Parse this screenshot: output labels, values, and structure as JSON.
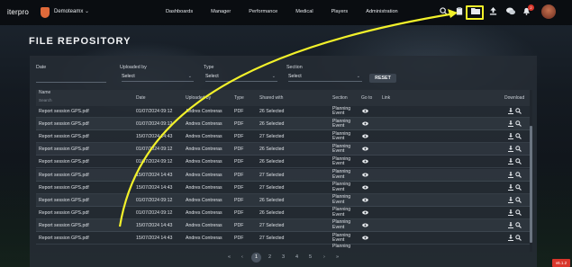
{
  "app": {
    "logo": "iterpro",
    "team": "Demoteamx",
    "nav": [
      "Dashboards",
      "Manager",
      "Performance",
      "Medical",
      "Players",
      "Administration"
    ],
    "notifications_count": "2",
    "accent_color": "#f2f12a",
    "version_badge": "v6.1.2"
  },
  "page": {
    "title": "FILE REPOSITORY"
  },
  "filters": {
    "date_label": "Date",
    "uploaded_by_label": "Uploaded by",
    "uploaded_by_value": "Select",
    "type_label": "Type",
    "type_value": "Select",
    "section_label": "Section",
    "section_value": "Select",
    "reset_label": "RESET"
  },
  "table": {
    "headers": {
      "name": "Name",
      "search_placeholder": "Search",
      "date": "Date",
      "uploaded_by": "Uploaded by",
      "type": "Type",
      "shared_with": "Shared with",
      "section": "Section",
      "go_to": "Go to",
      "link": "Link",
      "download": "Download"
    },
    "rows": [
      {
        "name": "Report session GPS.pdf",
        "date": "01/07/2024 09:12",
        "uploaded_by": "Andres Contreras",
        "type": "PDF",
        "shared_with": "26 Selected",
        "section_1": "Planning",
        "section_2": "Event"
      },
      {
        "name": "Report session GPS.pdf",
        "date": "01/07/2024 09:12",
        "uploaded_by": "Andres Contreras",
        "type": "PDF",
        "shared_with": "26 Selected",
        "section_1": "Planning",
        "section_2": "Event"
      },
      {
        "name": "Report session GPS.pdf",
        "date": "15/07/2024 14:43",
        "uploaded_by": "Andres Contreras",
        "type": "PDF",
        "shared_with": "27 Selected",
        "section_1": "Planning",
        "section_2": "Event"
      },
      {
        "name": "Report session GPS.pdf",
        "date": "01/07/2024 09:12",
        "uploaded_by": "Andres Contreras",
        "type": "PDF",
        "shared_with": "26 Selected",
        "section_1": "Planning",
        "section_2": "Event"
      },
      {
        "name": "Report session GPS.pdf",
        "date": "01/07/2024 09:12",
        "uploaded_by": "Andres Contreras",
        "type": "PDF",
        "shared_with": "26 Selected",
        "section_1": "Planning",
        "section_2": "Event"
      },
      {
        "name": "Report session GPS.pdf",
        "date": "15/07/2024 14:43",
        "uploaded_by": "Andres Contreras",
        "type": "PDF",
        "shared_with": "27 Selected",
        "section_1": "Planning",
        "section_2": "Event"
      },
      {
        "name": "Report session GPS.pdf",
        "date": "15/07/2024 14:43",
        "uploaded_by": "Andres Contreras",
        "type": "PDF",
        "shared_with": "27 Selected",
        "section_1": "Planning",
        "section_2": "Event"
      },
      {
        "name": "Report session GPS.pdf",
        "date": "01/07/2024 09:12",
        "uploaded_by": "Andres Contreras",
        "type": "PDF",
        "shared_with": "26 Selected",
        "section_1": "Planning",
        "section_2": "Event"
      },
      {
        "name": "Report session GPS.pdf",
        "date": "01/07/2024 09:12",
        "uploaded_by": "Andres Contreras",
        "type": "PDF",
        "shared_with": "26 Selected",
        "section_1": "Planning",
        "section_2": "Event"
      },
      {
        "name": "Report session GPS.pdf",
        "date": "15/07/2024 14:43",
        "uploaded_by": "Andres Contreras",
        "type": "PDF",
        "shared_with": "27 Selected",
        "section_1": "Planning",
        "section_2": "Event"
      },
      {
        "name": "Report session GPS.pdf",
        "date": "15/07/2024 14:43",
        "uploaded_by": "Andres Contreras",
        "type": "PDF",
        "shared_with": "27 Selected",
        "section_1": "Planning",
        "section_2": "Event"
      }
    ],
    "partial_row_label": "Planning"
  },
  "pagination": {
    "first": "«",
    "prev": "‹",
    "pages": [
      "1",
      "2",
      "3",
      "4",
      "5"
    ],
    "active_page": "1",
    "next": "›",
    "last": "»"
  },
  "icons": {
    "search": "search-icon",
    "folder": "folder-icon",
    "upload": "upload-icon",
    "chat": "chat-icon",
    "bell": "bell-icon",
    "eye": "eye-icon",
    "download": "download-icon"
  }
}
